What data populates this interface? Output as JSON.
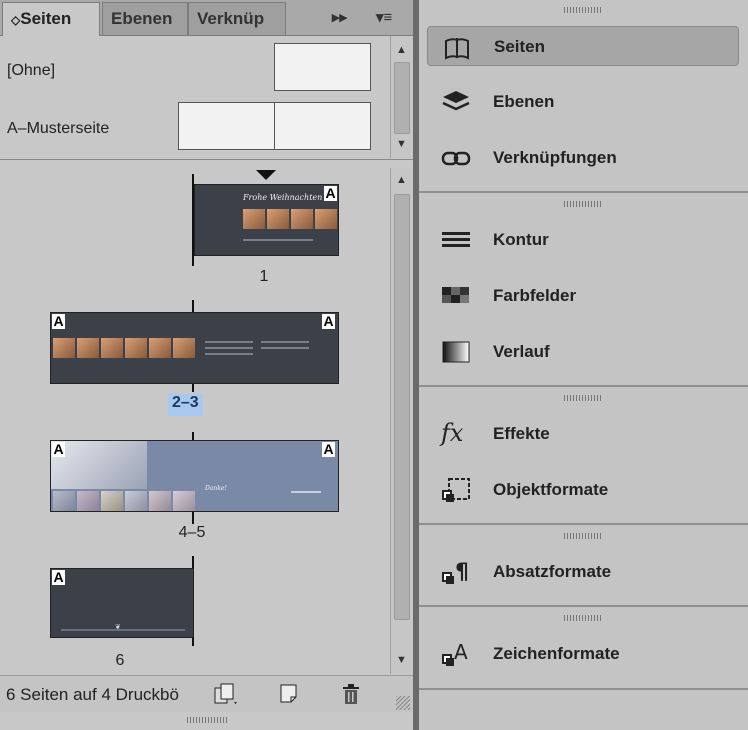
{
  "tabs": {
    "seiten": "Seiten",
    "ebenen": "Ebenen",
    "verknuepfungen": "Verknüp",
    "arrows": "▸▸",
    "menu": "▾≡"
  },
  "masters": {
    "none": "[Ohne]",
    "a": "A–Musterseite"
  },
  "pages": {
    "p1": "1",
    "p23": "2–3",
    "p45": "4–5",
    "p6": "6",
    "master_mark": "A",
    "spread1_title": "Frohe Weihnachten",
    "spread3_text": "Danke!"
  },
  "status": "6 Seiten auf 4 Druckbö",
  "right": {
    "seiten": "Seiten",
    "ebenen": "Ebenen",
    "verknuepfungen": "Verknüpfungen",
    "kontur": "Kontur",
    "farbfelder": "Farbfelder",
    "verlauf": "Verlauf",
    "effekte": "Effekte",
    "objektformate": "Objektformate",
    "absatzformate": "Absatzformate",
    "zeichenformate": "Zeichenformate"
  }
}
